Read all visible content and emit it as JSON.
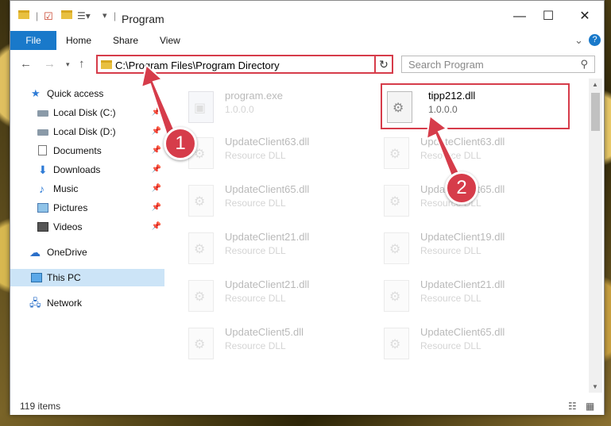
{
  "window": {
    "title": "Program",
    "minimize": "—",
    "maximize": "☐",
    "close": "✕"
  },
  "ribbon": {
    "file": "File",
    "tabs": [
      "Home",
      "Share",
      "View"
    ],
    "collapse": "⌄",
    "help": "?"
  },
  "address": {
    "path": "C:\\Program Files\\Program Directory",
    "search_placeholder": "Search Program"
  },
  "nav": {
    "items": [
      {
        "label": "Quick access",
        "icon": "star-icon",
        "pinned": false
      },
      {
        "label": "Local Disk (C:)",
        "icon": "disk-icon",
        "pinned": true
      },
      {
        "label": "Local Disk (D:)",
        "icon": "disk-icon",
        "pinned": true
      },
      {
        "label": "Documents",
        "icon": "document-icon",
        "pinned": true
      },
      {
        "label": "Downloads",
        "icon": "download-icon",
        "pinned": true
      },
      {
        "label": "Music",
        "icon": "music-icon",
        "pinned": true
      },
      {
        "label": "Pictures",
        "icon": "picture-icon",
        "pinned": true
      },
      {
        "label": "Videos",
        "icon": "video-icon",
        "pinned": true
      },
      {
        "label": "OneDrive",
        "icon": "cloud-icon",
        "pinned": false
      },
      {
        "label": "This PC",
        "icon": "computer-icon",
        "pinned": false,
        "selected": true
      },
      {
        "label": "Network",
        "icon": "network-icon",
        "pinned": false
      }
    ]
  },
  "files": [
    {
      "name": "program.exe",
      "desc": "1.0.0.0",
      "faded": true,
      "type": "exe"
    },
    {
      "name": "tipp212.dll",
      "desc": "1.0.0.0",
      "faded": false,
      "type": "dll"
    },
    {
      "name": "UpdateClient63.dll",
      "desc": "Resource DLL",
      "faded": true,
      "type": "dll"
    },
    {
      "name": "UpdateClient63.dll",
      "desc": "Resource DLL",
      "faded": true,
      "type": "dll"
    },
    {
      "name": "UpdateClient65.dll",
      "desc": "Resource DLL",
      "faded": true,
      "type": "dll"
    },
    {
      "name": "UpdateClient65.dll",
      "desc": "Resource DLL",
      "faded": true,
      "type": "dll"
    },
    {
      "name": "UpdateClient21.dll",
      "desc": "Resource DLL",
      "faded": true,
      "type": "dll"
    },
    {
      "name": "UpdateClient19.dll",
      "desc": "Resource DLL",
      "faded": true,
      "type": "dll"
    },
    {
      "name": "UpdateClient21.dll",
      "desc": "Resource DLL",
      "faded": true,
      "type": "dll"
    },
    {
      "name": "UpdateClient21.dll",
      "desc": "Resource DLL",
      "faded": true,
      "type": "dll"
    },
    {
      "name": "UpdateClient5.dll",
      "desc": "Resource DLL",
      "faded": true,
      "type": "dll"
    },
    {
      "name": "UpdateClient65.dll",
      "desc": "Resource DLL",
      "faded": true,
      "type": "dll"
    }
  ],
  "status": {
    "item_count": "119 items"
  },
  "callouts": [
    "1",
    "2"
  ],
  "colors": {
    "accent": "#1979ca",
    "highlight": "#d63c4a",
    "selected": "#cce4f7"
  }
}
